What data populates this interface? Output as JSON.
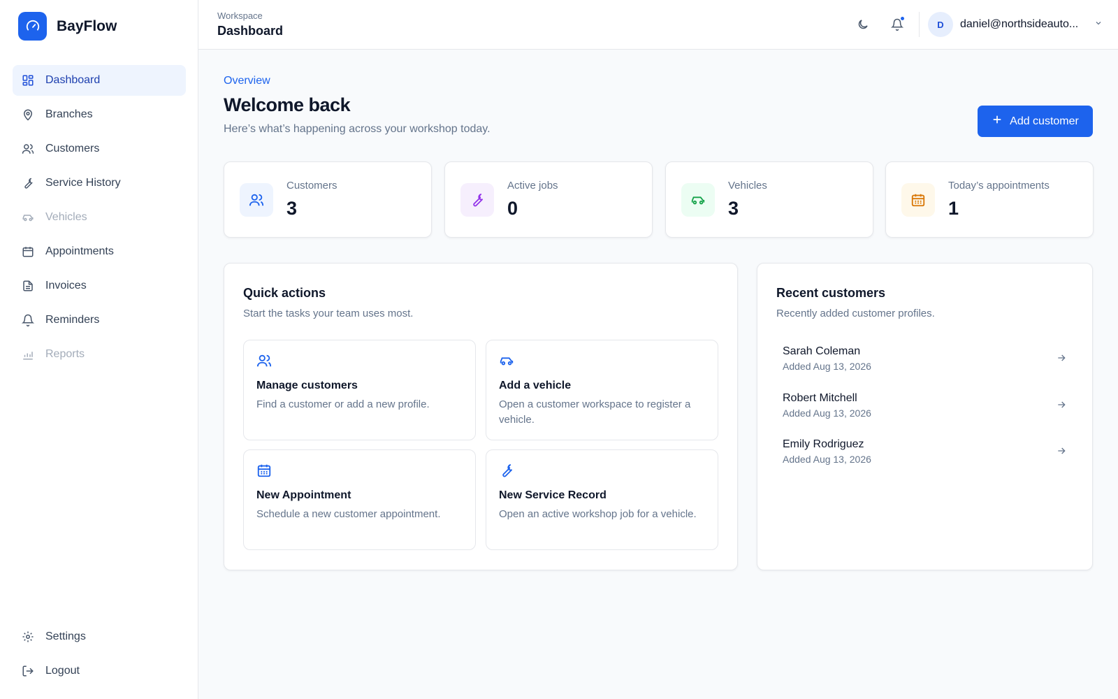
{
  "app": {
    "name": "BayFlow"
  },
  "sidebar": {
    "items": [
      {
        "label": "Dashboard",
        "icon": "dashboard-icon"
      },
      {
        "label": "Branches",
        "icon": "map-pin-icon"
      },
      {
        "label": "Customers",
        "icon": "users-icon"
      },
      {
        "label": "Service History",
        "icon": "wrench-icon"
      },
      {
        "label": "Vehicles",
        "icon": "car-icon"
      },
      {
        "label": "Appointments",
        "icon": "calendar-icon"
      },
      {
        "label": "Invoices",
        "icon": "file-icon"
      },
      {
        "label": "Reminders",
        "icon": "bell-icon"
      },
      {
        "label": "Reports",
        "icon": "chart-icon"
      }
    ],
    "bottom": [
      {
        "label": "Settings",
        "icon": "gear-icon"
      },
      {
        "label": "Logout",
        "icon": "logout-icon"
      }
    ]
  },
  "header": {
    "section": "Workspace",
    "title": "Dashboard",
    "user_initial": "D",
    "user_email": "daniel@northsideauto..."
  },
  "main": {
    "eyebrow": "Overview",
    "title": "Welcome back",
    "subtitle": "Here’s what’s happening across your workshop today.",
    "add_button": "Add customer"
  },
  "stats": [
    {
      "label": "Customers",
      "value": "3"
    },
    {
      "label": "Active jobs",
      "value": "0"
    },
    {
      "label": "Vehicles",
      "value": "3"
    },
    {
      "label": "Today’s appointments",
      "value": "1"
    }
  ],
  "colors": {
    "accent": "#1d63ed",
    "customers_bg": "#eef4fe",
    "jobs_bg": "#f6effd",
    "jobs_fg": "#9333ea",
    "vehicles_bg": "#ecfdf3",
    "vehicles_fg": "#16a34a",
    "appointments_bg": "#fef8ea",
    "appointments_fg": "#d97706"
  },
  "quick_actions": {
    "title": "Quick actions",
    "subtitle": "Start the tasks your team uses most.",
    "items": [
      {
        "title": "Manage customers",
        "desc": "Find a customer or add a new profile.",
        "icon": "users-icon"
      },
      {
        "title": "Add a vehicle",
        "desc": "Open a customer workspace to register a vehicle.",
        "icon": "car-icon"
      },
      {
        "title": "New Appointment",
        "desc": "Schedule a new customer appointment.",
        "icon": "calendar-icon"
      },
      {
        "title": "New Service Record",
        "desc": "Open an active workshop job for a vehicle.",
        "icon": "wrench-icon"
      }
    ]
  },
  "recent_customers": {
    "title": "Recent customers",
    "subtitle": "Recently added customer profiles.",
    "items": [
      {
        "name": "Sarah Coleman",
        "added": "Added Aug 13, 2026"
      },
      {
        "name": "Robert Mitchell",
        "added": "Added Aug 13, 2026"
      },
      {
        "name": "Emily Rodriguez",
        "added": "Added Aug 13, 2026"
      }
    ]
  }
}
